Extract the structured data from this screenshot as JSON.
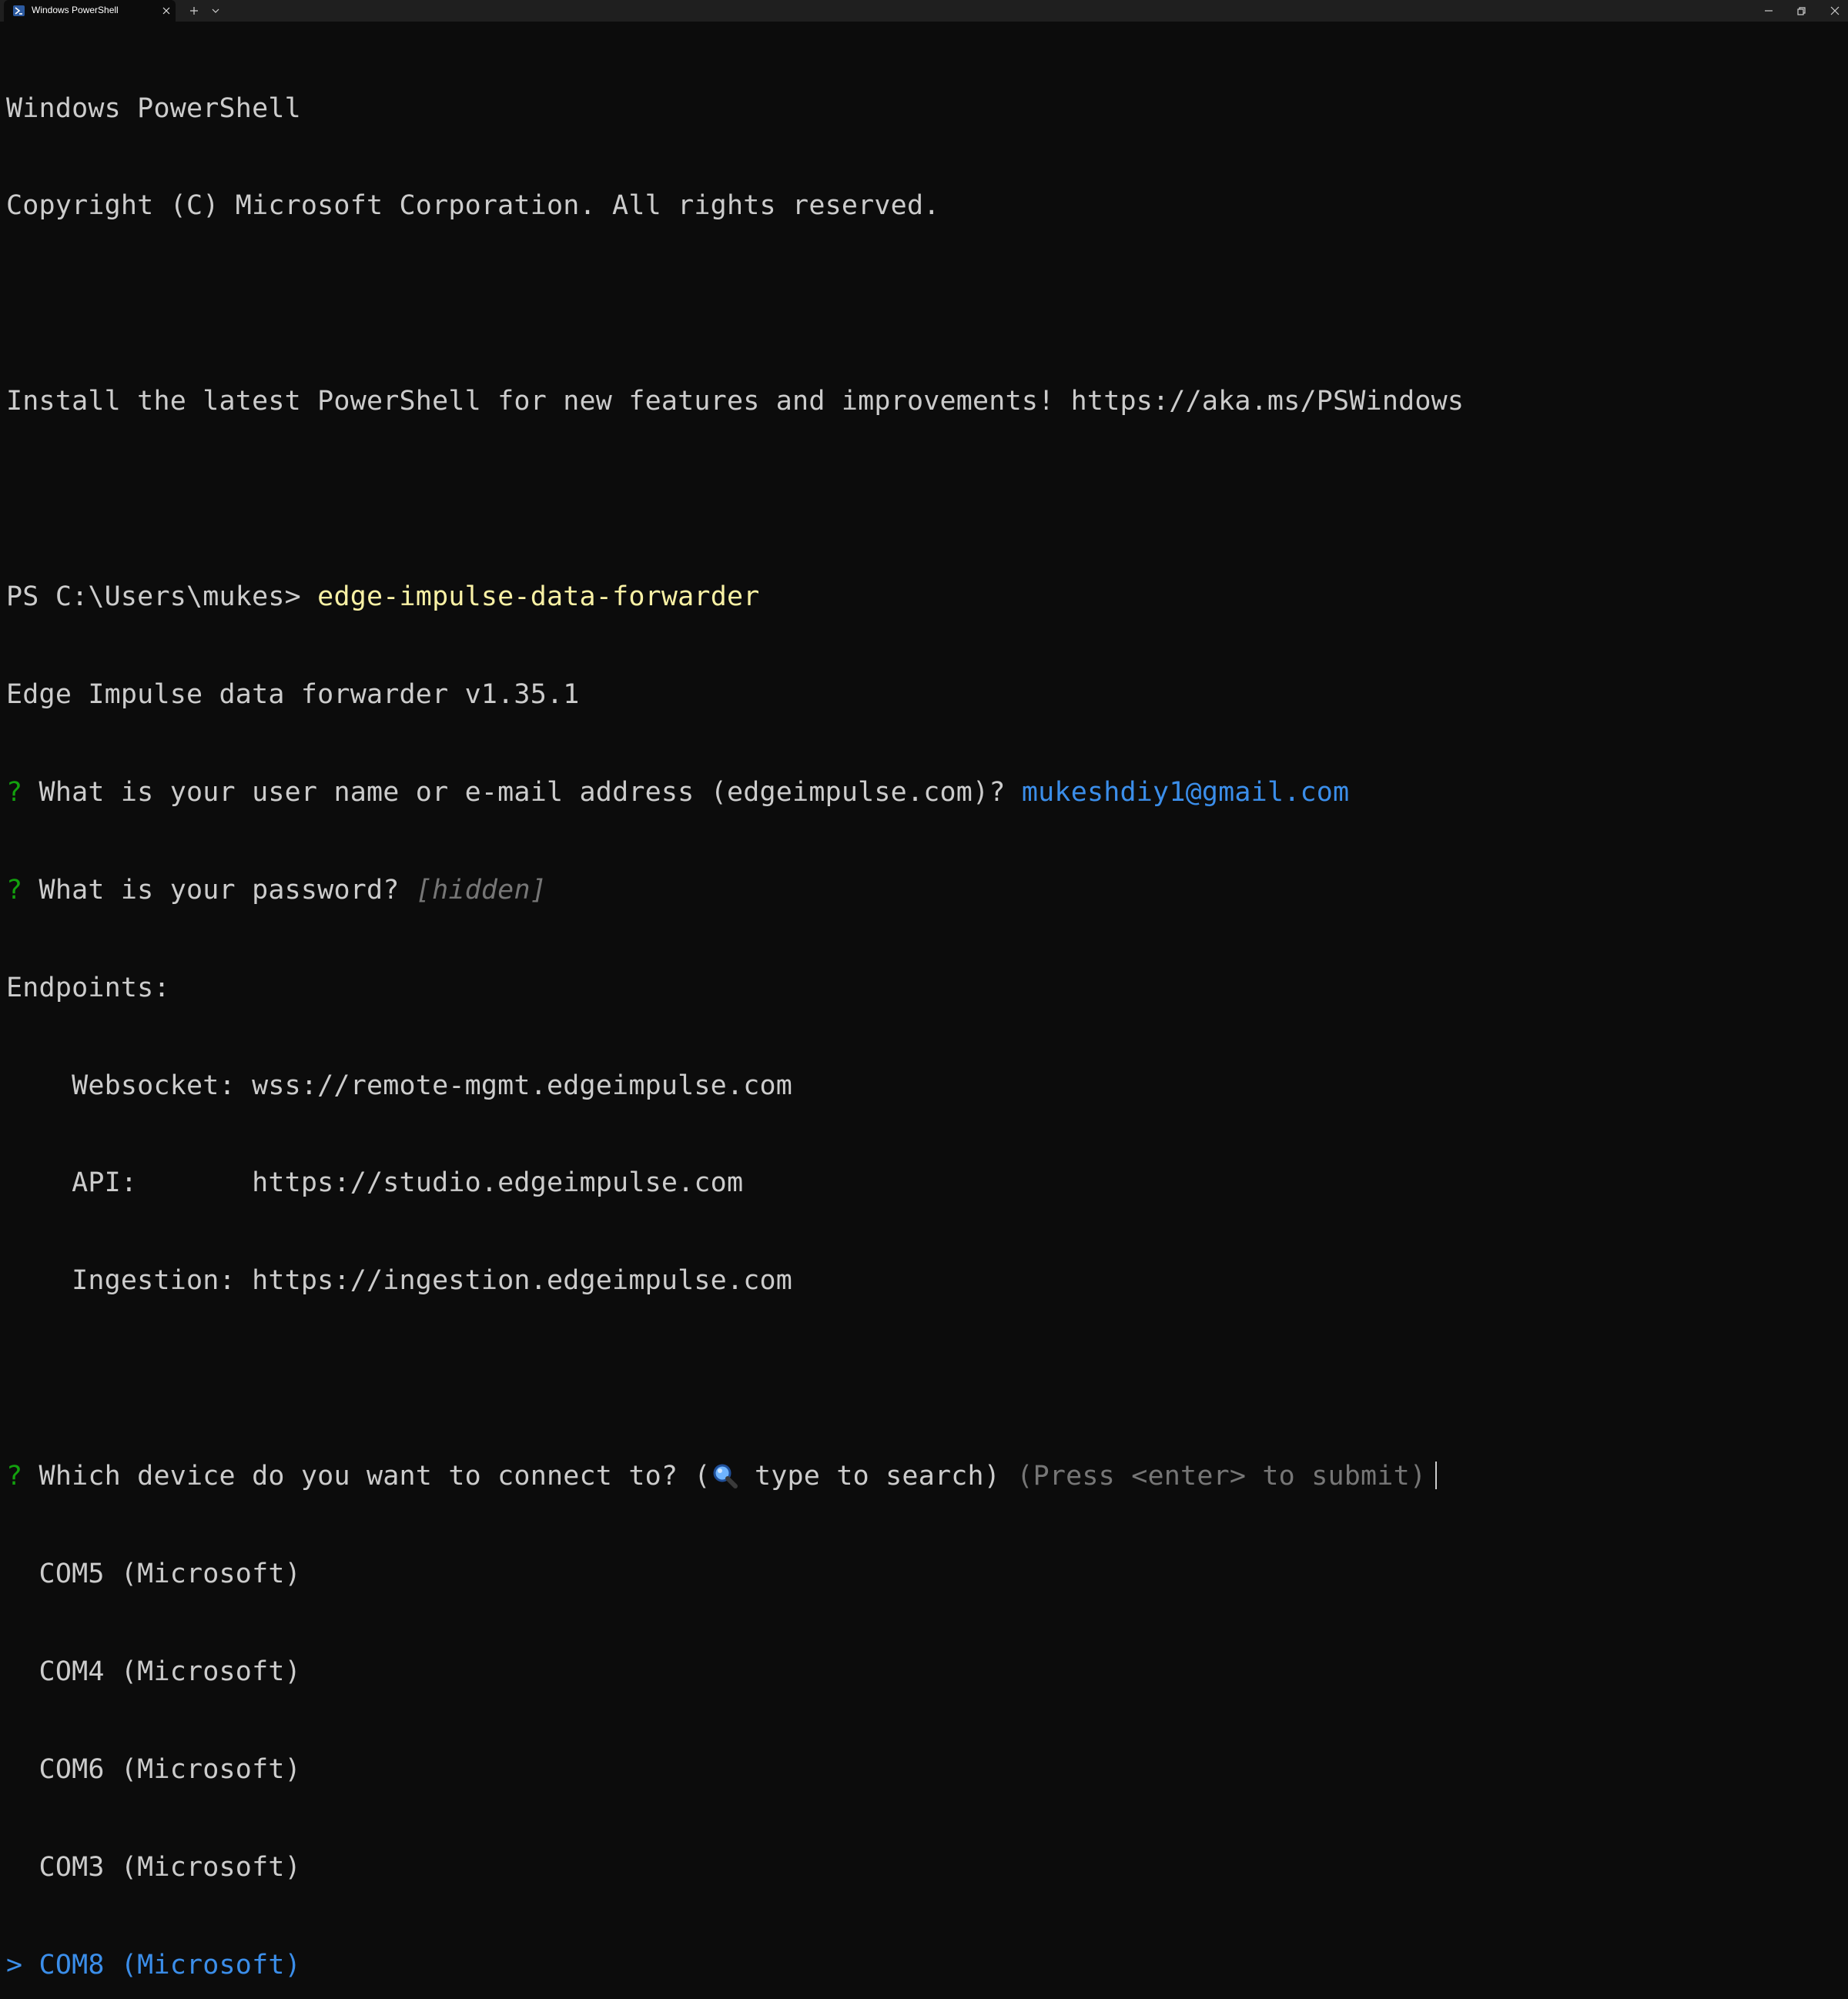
{
  "window": {
    "tab_title": "Windows PowerShell",
    "icons": {
      "tab": "powershell-icon",
      "close_tab": "close-icon",
      "new_tab": "plus-icon",
      "dropdown": "chevron-down-icon",
      "minimize": "minimize-icon",
      "maximize": "restore-icon",
      "close_window": "close-icon"
    }
  },
  "colors": {
    "background": "#0c0c0c",
    "text": "#cccccc",
    "command": "#f9f1a5",
    "prompt_mark": "#13a10e",
    "answer": "#3b8eea",
    "hint": "#767676"
  },
  "console": {
    "banner_title": "Windows PowerShell",
    "copyright": "Copyright (C) Microsoft Corporation. All rights reserved.",
    "install_msg": "Install the latest PowerShell for new features and improvements! https://aka.ms/PSWindows",
    "prompt": "PS C:\\Users\\mukes> ",
    "command": "edge-impulse-data-forwarder",
    "version": "Edge Impulse data forwarder v1.35.1",
    "q_mark": "?",
    "q_username": " What is your user name or e-mail address (edgeimpulse.com)? ",
    "a_username": "mukeshdiy1@gmail.com",
    "q_password": " What is your password? ",
    "a_password": "[hidden]",
    "endpoints_label": "Endpoints:",
    "ep_websocket": "    Websocket: wss://remote-mgmt.edgeimpulse.com",
    "ep_api": "    API:       https://studio.edgeimpulse.com",
    "ep_ingestion": "    Ingestion: https://ingestion.edgeimpulse.com",
    "q_device_a": " Which device do you want to connect to? (",
    "q_device_b": " type to search) ",
    "q_device_hint": "(Press <enter> to submit)",
    "search_icon": "magnifier-icon",
    "devices": [
      "  COM5 (Microsoft)",
      "  COM4 (Microsoft)",
      "  COM6 (Microsoft)",
      "  COM3 (Microsoft)"
    ],
    "selected_marker": "> ",
    "selected_device": "COM8 (Microsoft)"
  }
}
